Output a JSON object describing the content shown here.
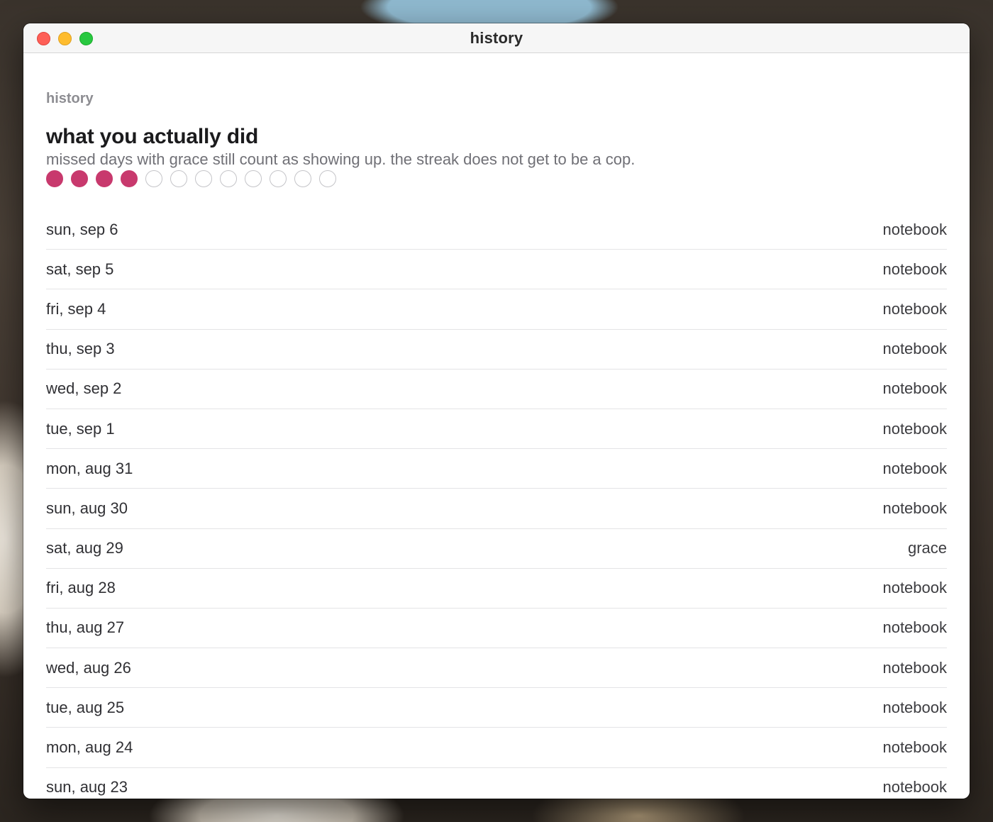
{
  "window": {
    "title": "history"
  },
  "page": {
    "eyebrow": "history",
    "heading": "what you actually did",
    "subtitle": "missed days with grace still count as showing up. the streak does not get to be a cop."
  },
  "streak": {
    "filled": 4,
    "total": 12,
    "accent_color": "#c8396d"
  },
  "history": [
    {
      "date": "sun, sep 6",
      "kind": "notebook"
    },
    {
      "date": "sat, sep 5",
      "kind": "notebook"
    },
    {
      "date": "fri, sep 4",
      "kind": "notebook"
    },
    {
      "date": "thu, sep 3",
      "kind": "notebook"
    },
    {
      "date": "wed, sep 2",
      "kind": "notebook"
    },
    {
      "date": "tue, sep 1",
      "kind": "notebook"
    },
    {
      "date": "mon, aug 31",
      "kind": "notebook"
    },
    {
      "date": "sun, aug 30",
      "kind": "notebook"
    },
    {
      "date": "sat, aug 29",
      "kind": "grace"
    },
    {
      "date": "fri, aug 28",
      "kind": "notebook"
    },
    {
      "date": "thu, aug 27",
      "kind": "notebook"
    },
    {
      "date": "wed, aug 26",
      "kind": "notebook"
    },
    {
      "date": "tue, aug 25",
      "kind": "notebook"
    },
    {
      "date": "mon, aug 24",
      "kind": "notebook"
    },
    {
      "date": "sun, aug 23",
      "kind": "notebook"
    }
  ]
}
